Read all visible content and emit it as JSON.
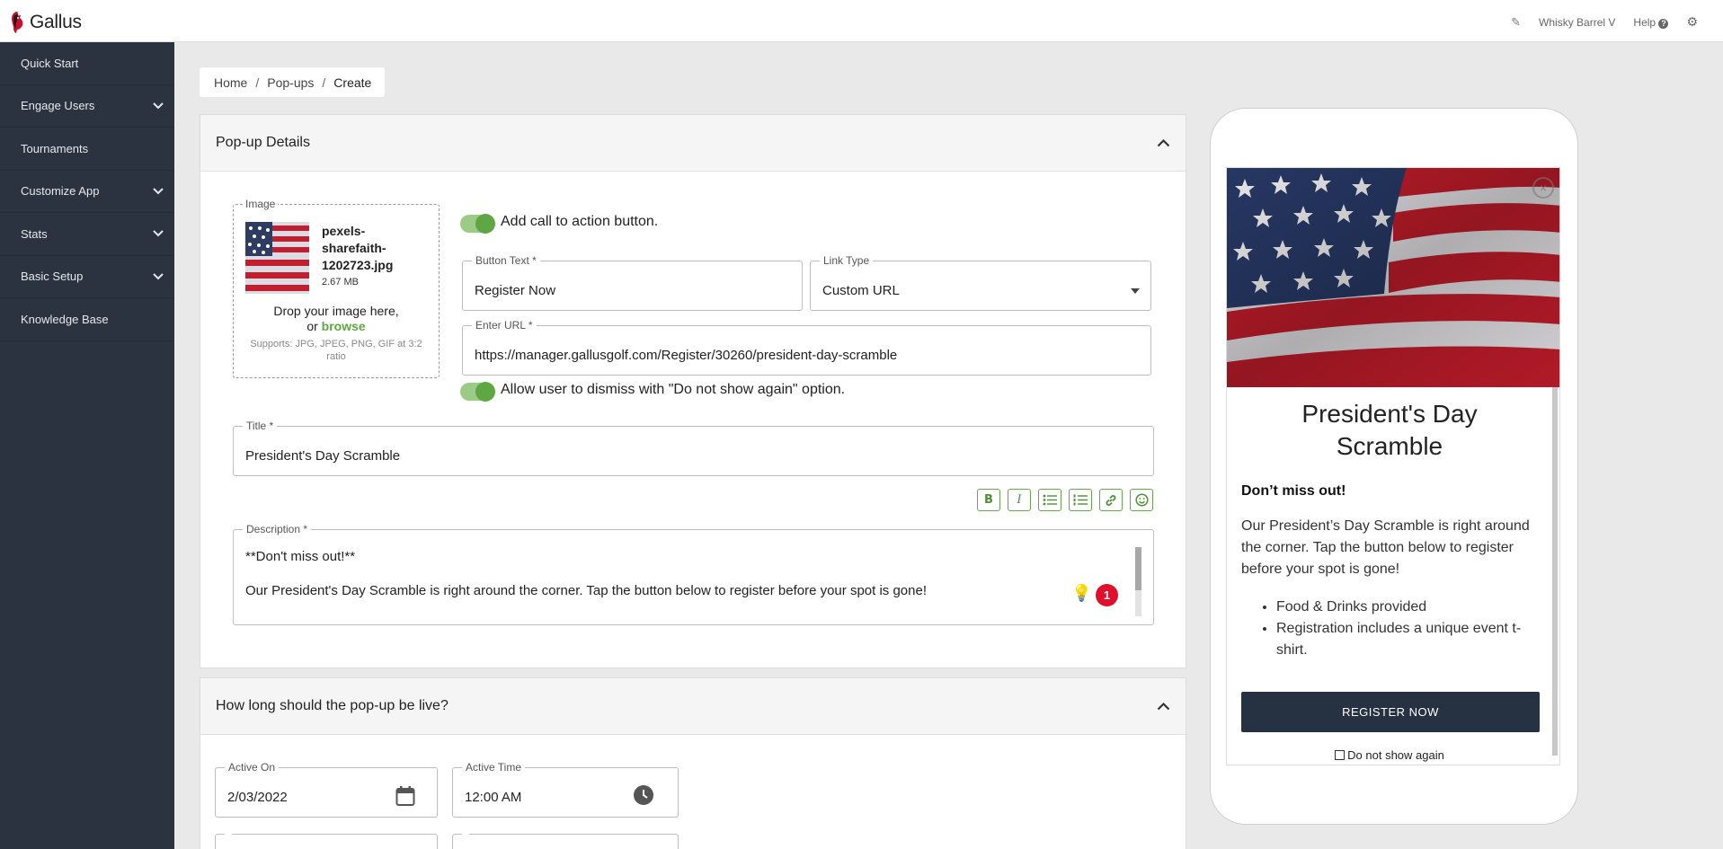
{
  "app": {
    "brand": "Gallus"
  },
  "topbar": {
    "account": "Whisky Barrel V",
    "help": "Help"
  },
  "sidebar": {
    "items": [
      {
        "label": "Quick Start",
        "expandable": false
      },
      {
        "label": "Engage Users",
        "expandable": true
      },
      {
        "label": "Tournaments",
        "expandable": false
      },
      {
        "label": "Customize App",
        "expandable": true
      },
      {
        "label": "Stats",
        "expandable": true
      },
      {
        "label": "Basic Setup",
        "expandable": true
      },
      {
        "label": "Knowledge Base",
        "expandable": false
      }
    ]
  },
  "breadcrumb": {
    "home": "Home",
    "section": "Pop-ups",
    "current": "Create",
    "separator": "/"
  },
  "details": {
    "header": "Pop-up Details",
    "image": {
      "label": "Image",
      "filename": "pexels-sharefaith-1202723.jpg",
      "filename_lines": [
        "pexels-",
        "sharefaith-",
        "1202723.jpg"
      ],
      "size": "2.67 MB",
      "drop_text": "Drop your image here,",
      "or_text": "or",
      "browse": "browse",
      "supports": "Supports: JPG, JPEG, PNG, GIF at 3:2 ratio"
    },
    "cta_toggle": {
      "label": "Add call to action button.",
      "on": true
    },
    "button_text": {
      "label": "Button Text *",
      "value": "Register Now"
    },
    "link_type": {
      "label": "Link Type",
      "value": "Custom URL"
    },
    "url": {
      "label": "Enter URL *",
      "value": "https://manager.gallusgolf.com/Register/30260/president-day-scramble"
    },
    "dismiss_toggle": {
      "label": "Allow user to dismiss with \"Do not show again\" option.",
      "on": true
    },
    "title": {
      "label": "Title *",
      "value": "President's Day Scramble"
    },
    "toolbar": [
      "bold-icon",
      "italic-icon",
      "bullet-list-icon",
      "numbered-list-icon",
      "link-icon",
      "emoji-icon"
    ],
    "description": {
      "label": "Description *",
      "line1": "**Don't miss out!**",
      "line2": "Our President's Day Scramble is right around the corner. Tap the button below to register before your spot is gone!",
      "badge": "1"
    }
  },
  "schedule": {
    "header": "How long should the pop-up be live?",
    "active_on": {
      "label": "Active On",
      "value": "2/03/2022"
    },
    "active_time": {
      "label": "Active Time",
      "value": "12:00 AM"
    }
  },
  "preview": {
    "title": "President's Day Scramble",
    "title_lines": [
      "President's Day",
      "Scramble"
    ],
    "bold": "Don’t miss out!",
    "text": "Our President’s Day Scramble is right around the corner. Tap the button below to register before your spot is gone!",
    "bullets": [
      "Food & Drinks provided",
      "Registration includes a unique event t-shirt."
    ],
    "button": "REGISTER NOW",
    "dont_show": "Do not show again"
  },
  "colors": {
    "sidebar": "#2c3340",
    "accent": "#5ea742",
    "badge": "#e0102c",
    "preview_button": "#263241"
  }
}
